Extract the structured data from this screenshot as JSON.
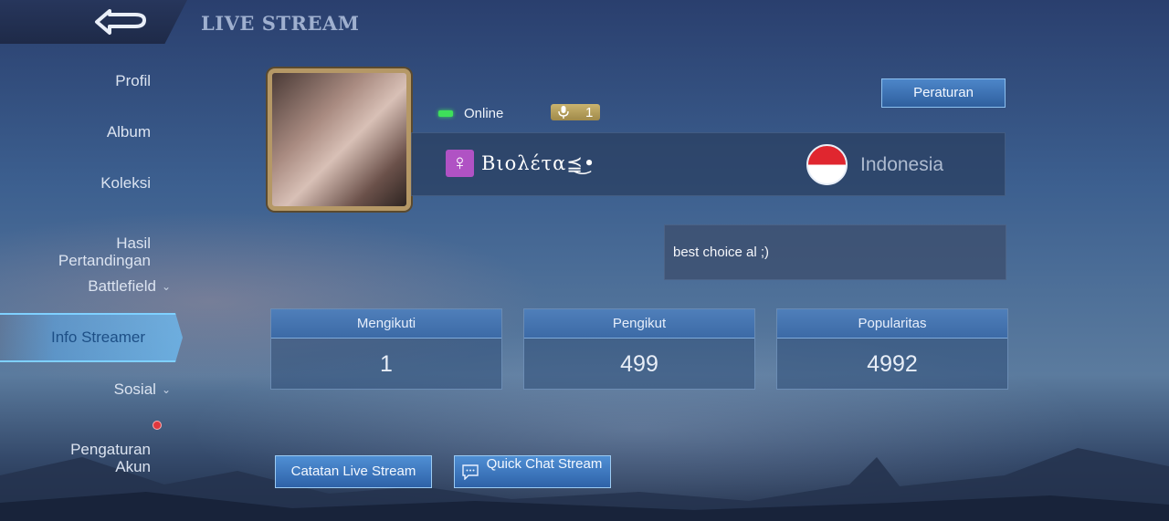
{
  "header": {
    "title": "LIVE STREAM",
    "back_icon": "back-arrow-icon"
  },
  "sidebar": {
    "items": [
      {
        "label": "Profil"
      },
      {
        "label": "Album"
      },
      {
        "label": "Koleksi"
      },
      {
        "label": "Hasil\nPertandingan"
      },
      {
        "label": "Battlefield",
        "expandable": true
      },
      {
        "label": "Info Streamer",
        "active": true
      },
      {
        "label": "Sosial",
        "expandable": true
      },
      {
        "label": "Pengaturan\nAkun",
        "notification": true
      }
    ]
  },
  "profile": {
    "status": "Online",
    "mic_count": "1",
    "name": "Βιολέτα⪳͜•",
    "gender_icon": "♀",
    "country": "Indonesia",
    "bio": "best choice al ;)",
    "rules_label": "Peraturan"
  },
  "stats": [
    {
      "label": "Mengikuti",
      "value": "1"
    },
    {
      "label": "Pengikut",
      "value": "499"
    },
    {
      "label": "Popularitas",
      "value": "4992"
    }
  ],
  "actions": {
    "log_label": "Catatan Live Stream",
    "quick_chat_label": "Quick Chat Stream"
  },
  "colors": {
    "online": "#3ee05a",
    "accent": "#4f8fd4",
    "gender_badge": "#b052c4",
    "mic_badge": "#c9b36e"
  }
}
